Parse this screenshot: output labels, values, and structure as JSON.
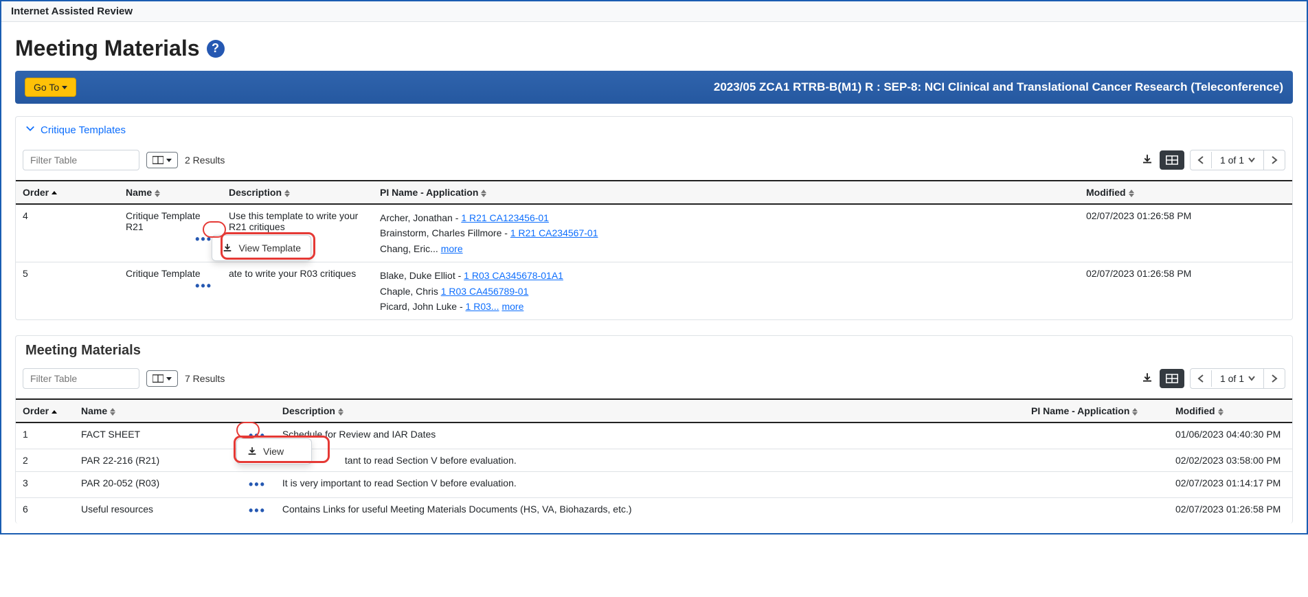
{
  "app_bar": {
    "title": "Internet Assisted Review"
  },
  "page": {
    "heading": "Meeting Materials",
    "help_glyph": "?"
  },
  "blue_header": {
    "goto_label": "Go To",
    "meeting_title": "2023/05 ZCA1 RTRB-B(M1) R : SEP-8: NCI Clinical and Translational Cancer Research (Teleconference)"
  },
  "critique_panel": {
    "title": "Critique Templates",
    "filter_placeholder": "Filter Table",
    "results": "2 Results",
    "pager": "1 of 1",
    "columns": {
      "order": "Order",
      "name": "Name",
      "description": "Description",
      "pi": "PI Name - Application",
      "modified": "Modified"
    },
    "popup_view_template": "View Template",
    "rows": [
      {
        "order": "4",
        "name": "Critique Template R21",
        "description": "Use this template to write your R21 critiques",
        "pi_lines": [
          {
            "name": "Archer, Jonathan",
            "sep": " -  ",
            "link": "1 R21 CA123456-01"
          },
          {
            "name": "Brainstorm, Charles Fillmore",
            "sep": " -  ",
            "link": "1 R21 CA234567-01 "
          },
          {
            "name": "Chang, Eric...",
            "sep": " ",
            "link": "more"
          }
        ],
        "modified": "02/07/2023 01:26:58 PM"
      },
      {
        "order": "5",
        "name": "Critique Template",
        "description": "ate to write your R03 critiques",
        "pi_lines": [
          {
            "name": "Blake, Duke Elliot",
            "sep": " -  ",
            "link": "1 R03 CA345678-01A1"
          },
          {
            "name": "Chaple, Chris",
            "sep": "   ",
            "link": "1 R03 CA456789-01"
          },
          {
            "name": "Picard, John Luke",
            "sep": " - ",
            "link": "1 R03..."
          },
          {
            "name": "",
            "sep": "   ",
            "link": "more"
          }
        ],
        "modified": "02/07/2023 01:26:58 PM"
      }
    ]
  },
  "materials_panel": {
    "title": "Meeting Materials",
    "filter_placeholder": "Filter Table",
    "results": "7 Results",
    "pager": "1 of 1",
    "columns": {
      "order": "Order",
      "name": "Name",
      "description": "Description",
      "pi": "PI Name - Application",
      "modified": "Modified"
    },
    "popup_view": "View",
    "rows": [
      {
        "order": "1",
        "name": "FACT SHEET",
        "description": "Schedule for Review and IAR Dates",
        "modified": "01/06/2023 04:40:30 PM"
      },
      {
        "order": "2",
        "name": "PAR 22-216 (R21)",
        "description": "tant to read Section V before evaluation.",
        "modified": "02/02/2023 03:58:00 PM"
      },
      {
        "order": "3",
        "name": "PAR 20-052 (R03)",
        "description": "It is very important to read Section V before evaluation.",
        "modified": "02/07/2023 01:14:17 PM"
      },
      {
        "order": "6",
        "name": "Useful resources",
        "description": "Contains Links for useful Meeting Materials Documents (HS, VA, Biohazards, etc.)",
        "modified": "02/07/2023 01:26:58 PM"
      }
    ]
  }
}
